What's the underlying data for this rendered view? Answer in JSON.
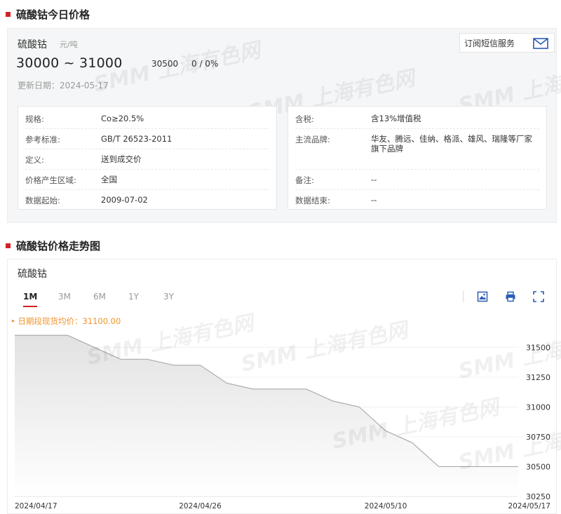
{
  "section1": {
    "title": "硫酸钴今日价格"
  },
  "price_card": {
    "product": "硫酸钴",
    "unit": "元/吨",
    "range": "30000 ~ 31000",
    "average": "30500",
    "change": "0 / 0%",
    "updated": "更新日期：2024-05-17",
    "sms_label": "订阅短信服务",
    "watermark": "SMM 上海有色网"
  },
  "specs_left": [
    {
      "k": "规格:",
      "v": "Co≥20.5%"
    },
    {
      "k": "参考标准:",
      "v": "GB/T 26523-2011"
    },
    {
      "k": "定义:",
      "v": "送到成交价"
    },
    {
      "k": "价格产生区域:",
      "v": "全国"
    },
    {
      "k": "数据起始:",
      "v": "2009-07-02"
    }
  ],
  "specs_right": [
    {
      "k": "含税:",
      "v": "含13%增值税"
    },
    {
      "k": "主流品牌:",
      "v": "华友、腾远、佳纳、格派、雄风、瑞隆等厂家旗下品牌"
    },
    {
      "k": "备注:",
      "v": "--"
    },
    {
      "k": "数据结束:",
      "v": "--"
    }
  ],
  "section2": {
    "title": "硫酸钴价格走势图"
  },
  "chart_card": {
    "product": "硫酸钴",
    "tabs": [
      "1M",
      "3M",
      "6M",
      "1Y",
      "3Y"
    ],
    "active_tab": "1M",
    "legend": "• 日期段现货均价：31100.00",
    "tools": [
      "image-download-icon",
      "print-icon",
      "fullscreen-icon"
    ]
  },
  "chart_data": {
    "type": "area",
    "x": [
      "2024-04-17",
      "2024-04-18",
      "2024-04-19",
      "2024-04-22",
      "2024-04-23",
      "2024-04-24",
      "2024-04-25",
      "2024-04-26",
      "2024-04-29",
      "2024-04-30",
      "2024-05-06",
      "2024-05-07",
      "2024-05-08",
      "2024-05-09",
      "2024-05-10",
      "2024-05-13",
      "2024-05-14",
      "2024-05-15",
      "2024-05-16",
      "2024-05-17"
    ],
    "y": [
      31600,
      31600,
      31600,
      31500,
      31400,
      31400,
      31350,
      31350,
      31200,
      31150,
      31150,
      31150,
      31050,
      31000,
      30800,
      30700,
      30500,
      30500,
      30500,
      30500
    ],
    "x_ticks": [
      "2024/04/17",
      "2024/04/26",
      "2024/05/10",
      "2024/05/17"
    ],
    "x_tick_index": [
      0,
      7,
      14,
      19
    ],
    "y_ticks": [
      31500,
      31250,
      31000,
      30750,
      30500,
      30250
    ],
    "ylim": [
      30250,
      31625
    ],
    "line_color": "#aaaaaa",
    "fill_top": "#e2e2e2",
    "fill_bottom": "#ffffff"
  }
}
